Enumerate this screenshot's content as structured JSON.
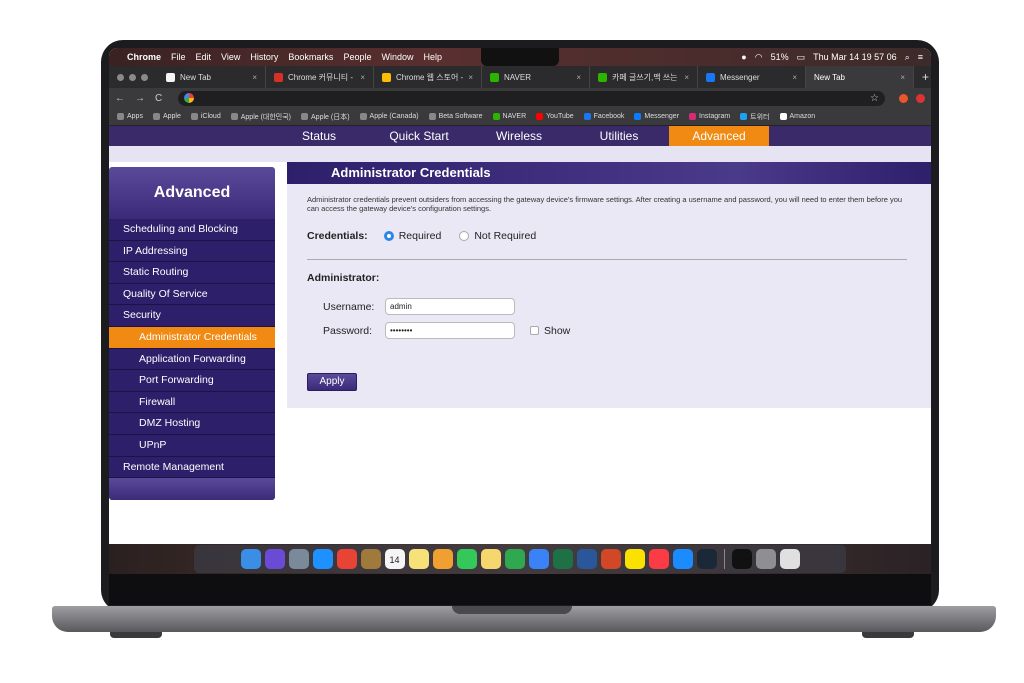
{
  "menubar": {
    "app": "Chrome",
    "items": [
      "File",
      "Edit",
      "View",
      "History",
      "Bookmarks",
      "People",
      "Window",
      "Help"
    ],
    "battery": "51%",
    "datetime": "Thu Mar 14  19 57 06"
  },
  "tabs": [
    {
      "label": "New Tab",
      "color": "#f5f5f5",
      "active": false
    },
    {
      "label": "Chrome 커뮤니티 - 'N",
      "color": "#d93025",
      "active": false
    },
    {
      "label": "Chrome 웹 스토어 - In",
      "color": "#fbbc05",
      "active": false
    },
    {
      "label": "NAVER",
      "color": "#2db400",
      "active": false
    },
    {
      "label": "카페 글쓰기,맥 쓰는 사람",
      "color": "#2db400",
      "active": false
    },
    {
      "label": "Messenger",
      "color": "#1877f2",
      "active": false
    },
    {
      "label": "New Tab",
      "color": "#3a3a3d",
      "active": true
    }
  ],
  "bookmarks": [
    "Apps",
    "Apple",
    "iCloud",
    "Apple (대한민국)",
    "Apple (日本)",
    "Apple (Canada)",
    "Beta Software",
    "NAVER",
    "YouTube",
    "Facebook",
    "Messenger",
    "Instagram",
    "트위터",
    "Amazon"
  ],
  "topnav": {
    "items": [
      "Status",
      "Quick Start",
      "Wireless",
      "Utilities",
      "Advanced"
    ],
    "active": "Advanced"
  },
  "sidebar": {
    "title": "Advanced",
    "items": [
      {
        "label": "Scheduling and Blocking",
        "sub": false,
        "active": false
      },
      {
        "label": "IP Addressing",
        "sub": false,
        "active": false
      },
      {
        "label": "Static Routing",
        "sub": false,
        "active": false
      },
      {
        "label": "Quality Of Service",
        "sub": false,
        "active": false
      },
      {
        "label": "Security",
        "sub": false,
        "active": false
      },
      {
        "label": "Administrator Credentials",
        "sub": true,
        "active": true
      },
      {
        "label": "Application Forwarding",
        "sub": true,
        "active": false
      },
      {
        "label": "Port Forwarding",
        "sub": true,
        "active": false
      },
      {
        "label": "Firewall",
        "sub": true,
        "active": false
      },
      {
        "label": "DMZ Hosting",
        "sub": true,
        "active": false
      },
      {
        "label": "UPnP",
        "sub": true,
        "active": false
      },
      {
        "label": "Remote Management",
        "sub": false,
        "active": false
      }
    ]
  },
  "content": {
    "title": "Administrator Credentials",
    "description": "Administrator credentials prevent outsiders from accessing the gateway device's firmware settings. After creating a username and password, you will need to enter them before you can access the gateway device's configuration settings.",
    "credentials_label": "Credentials:",
    "option_required": "Required",
    "option_not_required": "Not Required",
    "selected": "Required",
    "admin_label": "Administrator:",
    "username_label": "Username:",
    "username_value": "admin",
    "password_label": "Password:",
    "password_value": "••••••••",
    "show_label": "Show",
    "apply_label": "Apply"
  },
  "colors": {
    "purple": "#2e1f6b",
    "orange": "#f08a12",
    "lavender": "#eae8f5"
  },
  "dock_icons": [
    {
      "name": "finder",
      "color": "#3a8ee6"
    },
    {
      "name": "siri",
      "color": "#6a4bd6"
    },
    {
      "name": "launchpad",
      "color": "#7a8a9a"
    },
    {
      "name": "safari",
      "color": "#1e90ff"
    },
    {
      "name": "chrome",
      "color": "#e84335"
    },
    {
      "name": "notes-book",
      "color": "#a07a3a"
    },
    {
      "name": "calendar",
      "color": "#f5f5f5"
    },
    {
      "name": "notes",
      "color": "#f7e27a"
    },
    {
      "name": "photos",
      "color": "#f0a030"
    },
    {
      "name": "messages",
      "color": "#34c759"
    },
    {
      "name": "pages-pad",
      "color": "#f5d76e"
    },
    {
      "name": "numbers",
      "color": "#2fa84f"
    },
    {
      "name": "keynote",
      "color": "#3b82f6"
    },
    {
      "name": "excel",
      "color": "#1e7145"
    },
    {
      "name": "word",
      "color": "#2b579a"
    },
    {
      "name": "powerpoint",
      "color": "#d24726"
    },
    {
      "name": "kakaotalk",
      "color": "#fae100"
    },
    {
      "name": "music",
      "color": "#fc3c44"
    },
    {
      "name": "app-store",
      "color": "#1a8cff"
    },
    {
      "name": "steam",
      "color": "#1b2838"
    },
    {
      "name": "terminal",
      "color": "#111111"
    },
    {
      "name": "system-preferences",
      "color": "#8e8e93"
    },
    {
      "name": "preview",
      "color": "#e0e0e0"
    }
  ],
  "calendar_day": "14"
}
